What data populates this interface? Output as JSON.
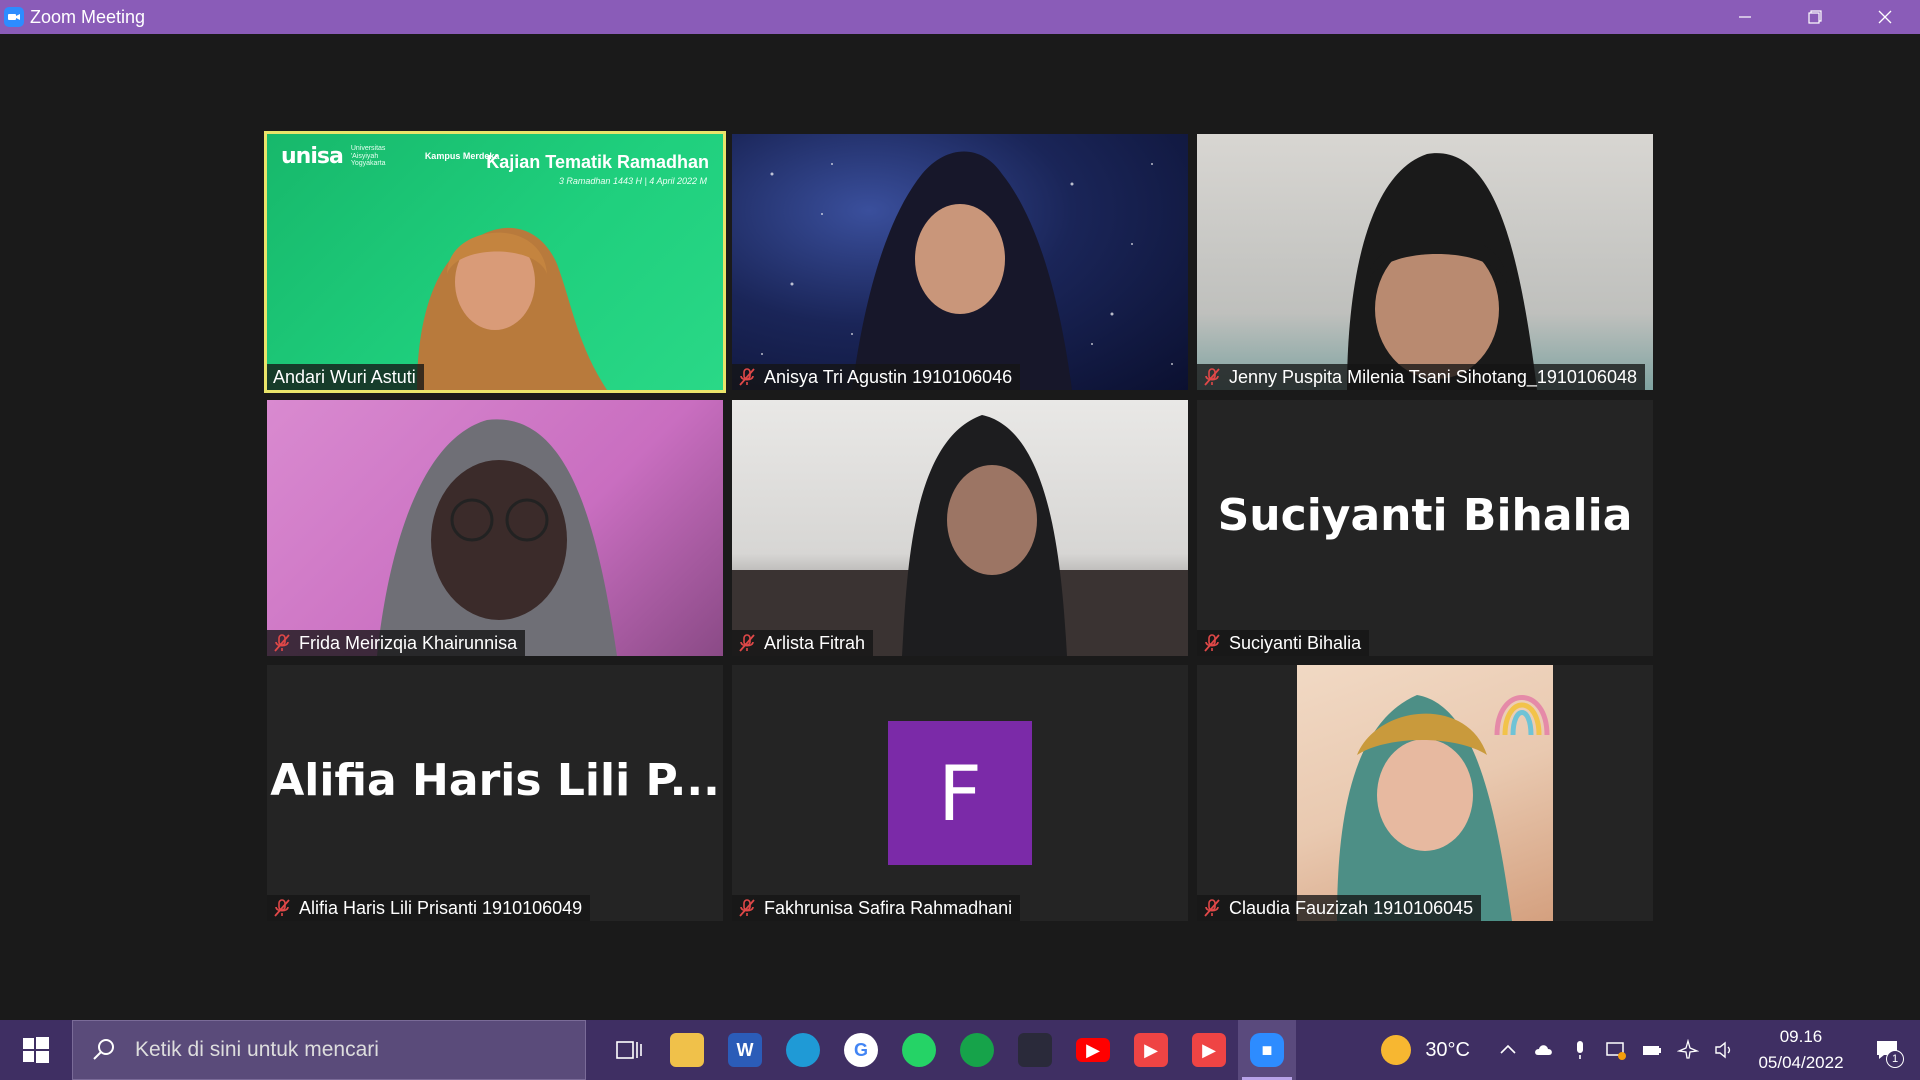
{
  "window": {
    "title": "Zoom Meeting"
  },
  "banner": {
    "logo": "unisa",
    "subtitle": "Universitas 'Aisyiyah Yogyakarta",
    "kampus": "Kampus Merdeka",
    "title": "Kajian Tematik Ramadhan",
    "date": "3 Ramadhan 1443 H | 4 April 2022 M"
  },
  "participants": [
    {
      "name": "Andari Wuri Astuti",
      "muted": false,
      "type": "video",
      "active": true
    },
    {
      "name": "Anisya Tri Agustin 1910106046",
      "muted": true,
      "type": "video"
    },
    {
      "name": "Jenny Puspita Milenia Tsani Sihotang_1910106048",
      "muted": true,
      "type": "video"
    },
    {
      "name": "Frida Meirizqia Khairunnisa",
      "muted": true,
      "type": "video"
    },
    {
      "name": "Arlista Fitrah",
      "muted": true,
      "type": "video"
    },
    {
      "name": "Suciyanti Bihalia",
      "muted": true,
      "type": "name",
      "display_name": "Suciyanti Bihalia"
    },
    {
      "name": "Alifia Haris Lili Prisanti 1910106049",
      "muted": true,
      "type": "name",
      "display_name": "Alifia Haris Lili P..."
    },
    {
      "name": "Fakhrunisa Safira Rahmadhani",
      "muted": true,
      "type": "avatar",
      "initial": "F",
      "avatar_color": "#7b2aa8"
    },
    {
      "name": "Claudia Fauzizah 1910106045",
      "muted": true,
      "type": "video"
    }
  ],
  "taskbar": {
    "search_placeholder": "Ketik di sini untuk mencari",
    "apps": [
      "task-view",
      "file-explorer",
      "word",
      "edge",
      "google-chrome",
      "whatsapp",
      "green-app",
      "app-dark",
      "youtube",
      "red-play",
      "red-play-2",
      "zoom"
    ],
    "weather": "30°C",
    "time": "09.16",
    "date": "05/04/2022",
    "notification_count": "1"
  },
  "colors": {
    "titlebar": "#8a5cb8",
    "taskbar": "#3f2f63",
    "active_speaker": "#e9e46a",
    "muted_icon": "#e04848"
  }
}
